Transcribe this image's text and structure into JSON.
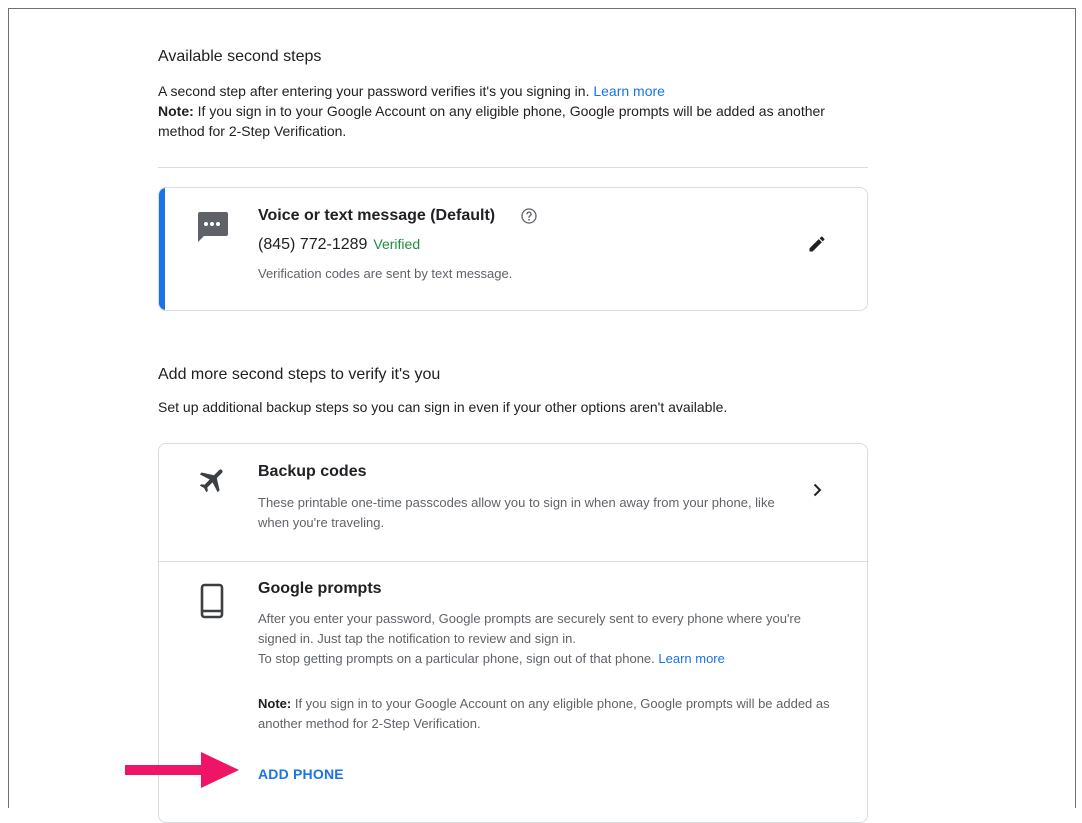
{
  "section1": {
    "heading": "Available second steps",
    "description": "A second step after entering your password verifies it's you signing in.",
    "learn_more": "Learn more",
    "note_label": "Note:",
    "note_text": "If you sign in to your Google Account on any eligible phone, Google prompts will be added as another method for 2-Step Verification."
  },
  "voice_card": {
    "icon": "sms-icon",
    "title": "Voice or text message (Default)",
    "phone": "(845) 772-1289",
    "status": "Verified",
    "subtitle": "Verification codes are sent by text message.",
    "accent_color": "#1a73e8"
  },
  "section2": {
    "heading": "Add more second steps to verify it's you",
    "description": "Set up additional backup steps so you can sign in even if your other options aren't available."
  },
  "backup_codes": {
    "icon": "airplane-icon",
    "title": "Backup codes",
    "description": "These printable one-time passcodes allow you to sign in when away from your phone, like when you're traveling."
  },
  "google_prompts": {
    "icon": "phone-icon",
    "title": "Google prompts",
    "description": "After you enter your password, Google prompts are securely sent to every phone where you're signed in. Just tap the notification to review and sign in.",
    "stop_text": "To stop getting prompts on a particular phone, sign out of that phone.",
    "learn_more": "Learn more",
    "note_label": "Note:",
    "note_text": "If you sign in to your Google Account on any eligible phone, Google prompts will be added as another method for 2-Step Verification.",
    "add_phone": "ADD PHONE"
  },
  "colors": {
    "link": "#1a73e8",
    "verified": "#1e8e3e",
    "annotation_arrow": "#ef1566"
  }
}
